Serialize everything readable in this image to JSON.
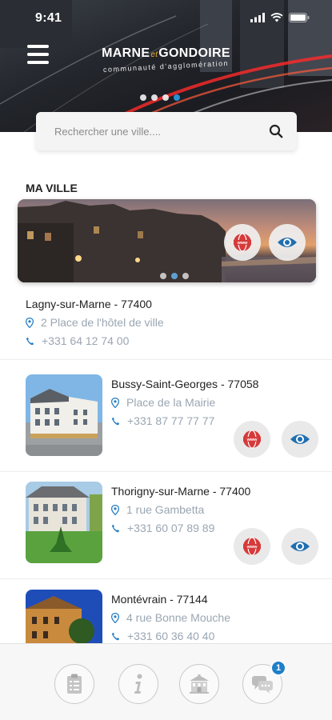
{
  "status_bar": {
    "time": "9:41"
  },
  "header": {
    "brand_left": "MARNE",
    "brand_et": "et",
    "brand_right": "GONDOIRE",
    "brand_subtitle": "communauté d'agglomération",
    "carousel_pages": 4,
    "carousel_active": 3
  },
  "search": {
    "placeholder": "Rechercher une ville...."
  },
  "my_city": {
    "section_title": "MA VILLE",
    "name": "Lagny-sur-Marne - 77400",
    "address": "2 Place de l'hôtel de ville",
    "phone": "+331 64 12 74 00",
    "carousel_pages": 3,
    "carousel_active": 1
  },
  "cities": [
    {
      "name": "Bussy-Saint-Georges - 77058",
      "address": "Place de la Mairie",
      "phone": "+331 87 77 77 77"
    },
    {
      "name": "Thorigny-sur-Marne - 77400",
      "address": "1 rue Gambetta",
      "phone": "+331 60 07 89 89"
    },
    {
      "name": "Montévrain - 77144",
      "address": "4 rue Bonne Mouche",
      "phone": "+331 60 36 40 40"
    }
  ],
  "bottom_nav": {
    "items": [
      "clipboard-icon",
      "info-icon",
      "town-hall-icon",
      "chat-icon"
    ],
    "chat_badge": "1"
  },
  "colors": {
    "accent": "#1f7fc7",
    "web_red": "#d63a3a",
    "muted_text": "#9aa6b2"
  }
}
